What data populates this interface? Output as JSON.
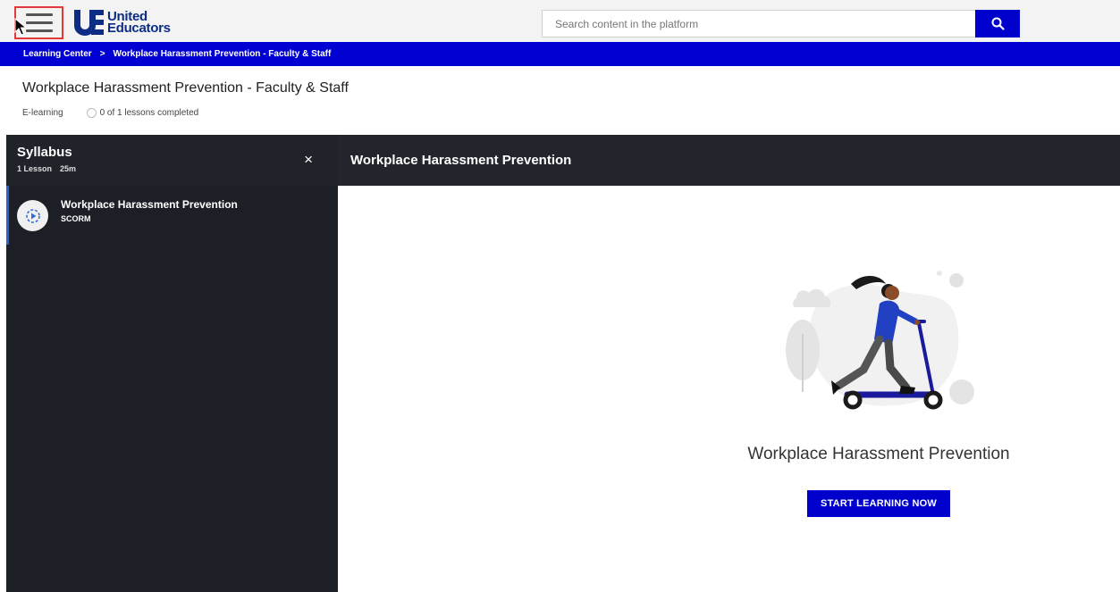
{
  "header": {
    "logo_line1": "United",
    "logo_line2": "Educators",
    "search": {
      "placeholder": "Search content in the platform"
    }
  },
  "breadcrumb": {
    "items": [
      "Learning Center",
      "Workplace Harassment Prevention - Faculty & Staff"
    ],
    "separator": ">"
  },
  "course": {
    "title": "Workplace Harassment Prevention - Faculty & Staff",
    "type": "E-learning",
    "progress": "0 of 1 lessons completed",
    "lessons_completed": 0,
    "lessons_total": 1
  },
  "syllabus": {
    "title": "Syllabus",
    "lesson_count": "1 Lesson",
    "duration": "25m",
    "close_symbol": "×",
    "lessons": [
      {
        "title": "Workplace Harassment Prevention",
        "type": "SCORM",
        "icon": "play-circle-icon"
      }
    ]
  },
  "content": {
    "header_title": "Workplace Harassment Prevention",
    "hero_title": "Workplace Harassment Prevention",
    "cta_label": "START LEARNING NOW",
    "illustration": "woman-on-scooter-illustration"
  },
  "colors": {
    "brand_blue": "#0000cc",
    "breadcrumb_bg": "#0000d2",
    "sidebar_bg": "#1c1f25",
    "content_header_bg": "#22252c",
    "highlight_border": "#e23a3a"
  }
}
